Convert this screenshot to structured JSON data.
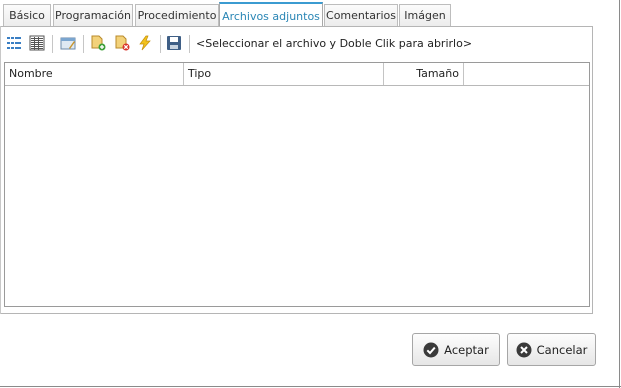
{
  "tabs": [
    {
      "label": "Básico",
      "active": false
    },
    {
      "label": "Programación",
      "active": false
    },
    {
      "label": "Procedimiento",
      "active": false
    },
    {
      "label": "Archivos adjuntos",
      "active": true
    },
    {
      "label": "Comentarios",
      "active": false
    },
    {
      "label": "Imágen",
      "active": false
    }
  ],
  "toolbar": {
    "hint": "<Seleccionar el archivo y Doble Clik para abrirlo>"
  },
  "grid": {
    "columns": [
      "Nombre",
      "Tipo",
      "Tamaño",
      ""
    ],
    "rows": []
  },
  "buttons": {
    "accept": "Aceptar",
    "cancel": "Cancelar"
  },
  "colors": {
    "active_tab_text": "#2a86b5",
    "active_tab_top": "#3b9bd1"
  }
}
